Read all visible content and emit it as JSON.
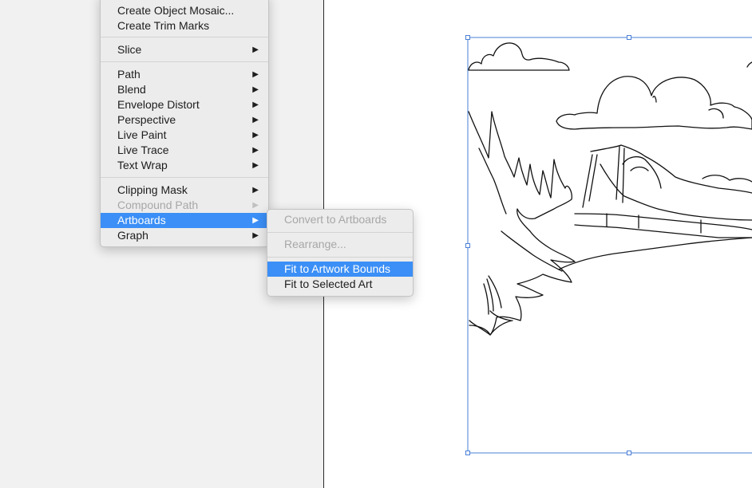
{
  "main_menu": {
    "items": [
      {
        "label": "Create Object Mosaic...",
        "submenu": false,
        "disabled": false
      },
      {
        "label": "Create Trim Marks",
        "submenu": false,
        "disabled": false
      },
      {
        "label": "Slice",
        "submenu": true,
        "disabled": false
      },
      {
        "label": "Path",
        "submenu": true,
        "disabled": false
      },
      {
        "label": "Blend",
        "submenu": true,
        "disabled": false
      },
      {
        "label": "Envelope Distort",
        "submenu": true,
        "disabled": false
      },
      {
        "label": "Perspective",
        "submenu": true,
        "disabled": false
      },
      {
        "label": "Live Paint",
        "submenu": true,
        "disabled": false
      },
      {
        "label": "Live Trace",
        "submenu": true,
        "disabled": false
      },
      {
        "label": "Text Wrap",
        "submenu": true,
        "disabled": false
      },
      {
        "label": "Clipping Mask",
        "submenu": true,
        "disabled": false
      },
      {
        "label": "Compound Path",
        "submenu": true,
        "disabled": true
      },
      {
        "label": "Artboards",
        "submenu": true,
        "disabled": false,
        "highlighted": true
      },
      {
        "label": "Graph",
        "submenu": true,
        "disabled": false
      }
    ],
    "submenu_arrow": "▶"
  },
  "artboards_submenu": {
    "items": [
      {
        "label": "Convert to Artboards",
        "disabled": true
      },
      {
        "label": "Rearrange...",
        "disabled": true
      },
      {
        "label": "Fit to Artwork Bounds",
        "disabled": false,
        "highlighted": true
      },
      {
        "label": "Fit to Selected Art",
        "disabled": false
      }
    ]
  },
  "colors": {
    "highlight": "#3b8ff6",
    "selection_bounds": "#4a7fd6",
    "menu_background": "#ececec",
    "pasteboard": "#f1f1f1"
  },
  "icons": {
    "submenu_arrow": "triangle-right-icon"
  }
}
